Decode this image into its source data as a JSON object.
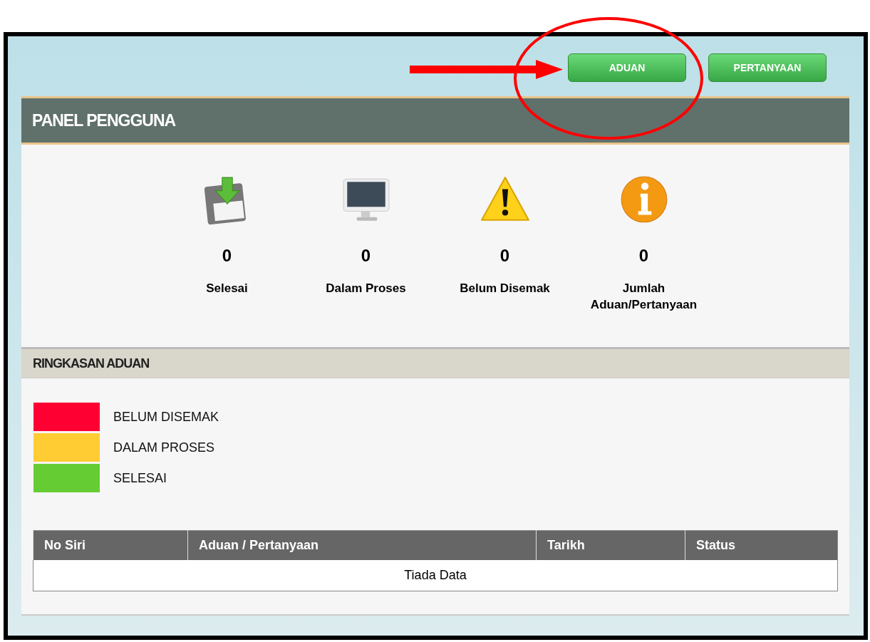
{
  "buttons": [
    {
      "label": "ADUAN"
    },
    {
      "label": "PERTANYAAN"
    }
  ],
  "panel": {
    "title": "PANEL PENGGUNA"
  },
  "stats": [
    {
      "kind": "saved",
      "value": "0",
      "label": "Selesai"
    },
    {
      "kind": "monitor",
      "value": "0",
      "label": "Dalam Proses"
    },
    {
      "kind": "warning",
      "value": "0",
      "label": "Belum Disemak"
    },
    {
      "kind": "info",
      "value": "0",
      "label": "Jumlah Aduan/Pertanyaan"
    }
  ],
  "summary": {
    "title": "RINGKASAN ADUAN"
  },
  "legend": [
    {
      "label": "BELUM DISEMAK",
      "color": "#ff0033"
    },
    {
      "label": "DALAM PROSES",
      "color": "#ffcc33"
    },
    {
      "label": "SELESAI",
      "color": "#66cc33"
    }
  ],
  "table": {
    "columns": [
      "No Siri",
      "Aduan / Pertanyaan",
      "Tarikh",
      "Status"
    ],
    "empty_message": "Tiada Data"
  }
}
